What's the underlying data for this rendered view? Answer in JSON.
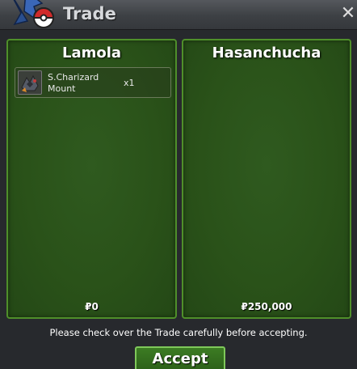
{
  "window": {
    "title": "Trade",
    "close_icon": "close-icon",
    "logo_icon": "pokeball-logo-icon"
  },
  "left_panel": {
    "player_name": "Lamola",
    "items": [
      {
        "name": "S.Charizard Mount",
        "quantity": "x1",
        "icon": "charizard-mount-icon"
      }
    ],
    "money": "₽0"
  },
  "right_panel": {
    "player_name": "Hasanchucha",
    "items": [],
    "money": "₽250,000"
  },
  "notice": "Please check over the Trade carefully before accepting.",
  "accept_label": "Accept",
  "colors": {
    "panel_border": "#4f8f2a",
    "panel_fill": "#2a5219",
    "button_fill": "#3c7c23"
  }
}
